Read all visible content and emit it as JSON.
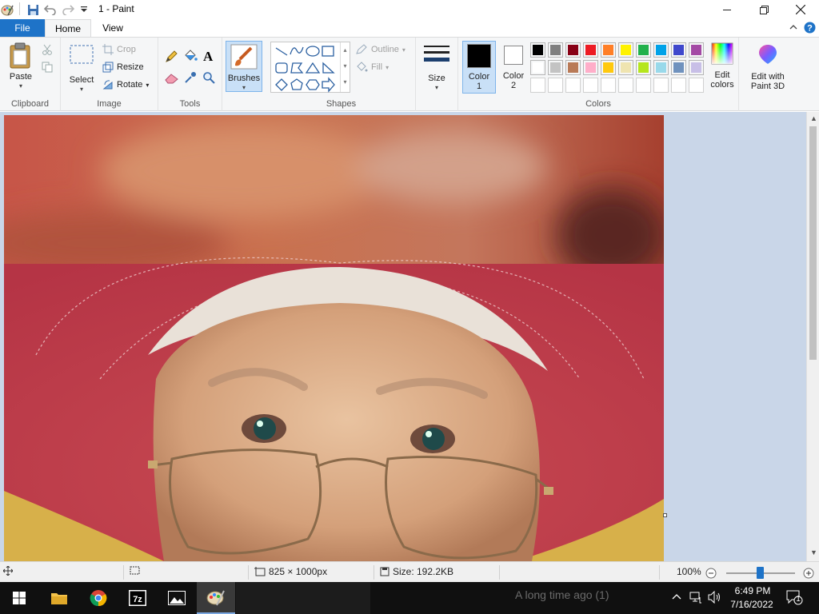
{
  "window": {
    "title": "1 - Paint",
    "minimize_icon": "minimize-icon",
    "maximize_icon": "restore-icon",
    "close_icon": "close-icon"
  },
  "tabs": {
    "file": "File",
    "home": "Home",
    "view": "View"
  },
  "ribbon": {
    "clipboard": {
      "label": "Clipboard",
      "paste": "Paste"
    },
    "image": {
      "label": "Image",
      "select": "Select",
      "crop": "Crop",
      "resize": "Resize",
      "rotate": "Rotate"
    },
    "tools": {
      "label": "Tools"
    },
    "brushes": "Brushes",
    "shapes": {
      "label": "Shapes",
      "outline": "Outline",
      "fill": "Fill"
    },
    "size": "Size",
    "colors": {
      "label": "Colors",
      "color1": "Color",
      "color1_num": "1",
      "color2": "Color",
      "color2_num": "2",
      "edit_colors_1": "Edit",
      "edit_colors_2": "colors",
      "edit_paint3d_1": "Edit with",
      "edit_paint3d_2": "Paint 3D",
      "palette_row1": [
        "#000000",
        "#7f7f7f",
        "#880015",
        "#ed1c24",
        "#ff7f27",
        "#fff200",
        "#22b14c",
        "#00a2e8",
        "#3f48cc",
        "#a349a4"
      ],
      "palette_row2": [
        "#ffffff",
        "#c3c3c3",
        "#b97a57",
        "#ffaec9",
        "#ffc90e",
        "#efe4b0",
        "#b5e61d",
        "#99d9ea",
        "#7092be",
        "#c8bfe7"
      ],
      "color1_value": "#000000",
      "color2_value": "#ffffff"
    }
  },
  "status": {
    "dimensions": "825 × 1000px",
    "size": "Size: 192.2KB",
    "zoom": "100%"
  },
  "taskbar": {
    "ghost_text": "A long time ago (1)",
    "time": "6:49 PM",
    "date": "7/16/2022",
    "notifications": "1"
  }
}
